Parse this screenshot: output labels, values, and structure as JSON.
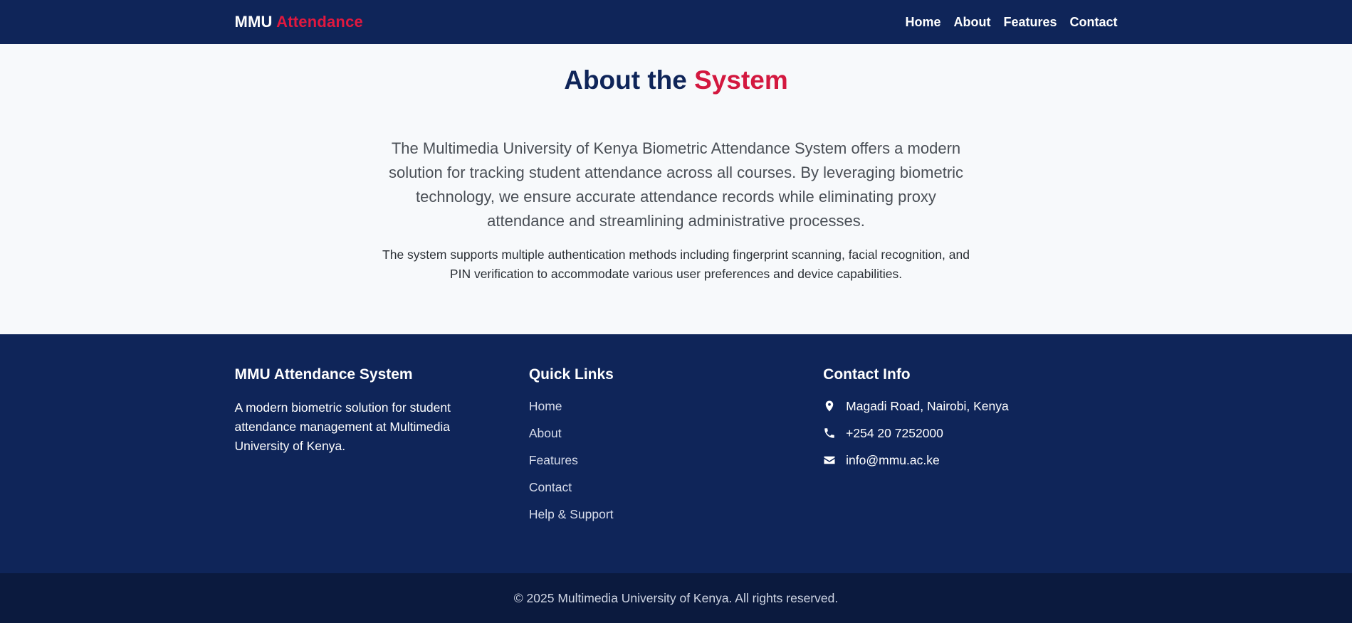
{
  "navbar": {
    "brand_main": "MMU",
    "brand_accent": "Attendance",
    "links": [
      "Home",
      "About",
      "Features",
      "Contact"
    ]
  },
  "about": {
    "title_main": "About the",
    "title_accent": "System",
    "lead": "The Multimedia University of Kenya Biometric Attendance System offers a modern solution for tracking student attendance across all courses. By leveraging biometric technology, we ensure accurate attendance records while eliminating proxy attendance and streamlining administrative processes.",
    "sub": "The system supports multiple authentication methods including fingerprint scanning, facial recognition, and PIN verification to accommodate various user preferences and device capabilities."
  },
  "footer": {
    "col1": {
      "heading": "MMU Attendance System",
      "text": "A modern biometric solution for student attendance management at Multimedia University of Kenya."
    },
    "col2": {
      "heading": "Quick Links",
      "links": [
        "Home",
        "About",
        "Features",
        "Contact",
        "Help & Support"
      ]
    },
    "col3": {
      "heading": "Contact Info",
      "address": "Magadi Road, Nairobi, Kenya",
      "phone": "+254 20 7252000",
      "email": "info@mmu.ac.ke",
      "icons": [
        "map-marker-icon",
        "phone-icon",
        "envelope-icon"
      ]
    }
  },
  "copyright": "© 2025 Multimedia University of Kenya. All rights reserved.",
  "colors": {
    "navy": "#0f2559",
    "accent": "#d3183f",
    "footer_bottom": "#0b1a3e",
    "page_bg": "#f7f9fb"
  }
}
